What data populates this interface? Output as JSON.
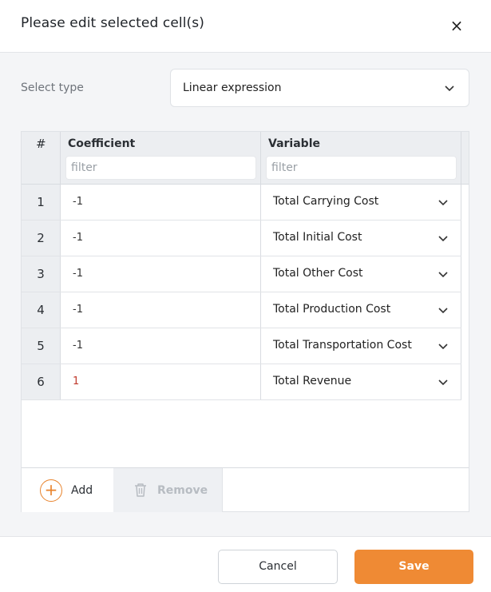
{
  "dialog": {
    "title": "Please edit selected cell(s)",
    "close_icon": "close-icon",
    "close_glyph": "×"
  },
  "type_select": {
    "label": "Select type",
    "value": "Linear expression",
    "icon": "chevron-down-icon"
  },
  "table": {
    "columns": {
      "num": "#",
      "coefficient": "Coefficient",
      "variable": "Variable"
    },
    "filter_placeholder": "filter",
    "rows": [
      {
        "num": "1",
        "coefficient": "-1",
        "variable": "Total Carrying Cost"
      },
      {
        "num": "2",
        "coefficient": "-1",
        "variable": "Total Initial Cost"
      },
      {
        "num": "3",
        "coefficient": "-1",
        "variable": "Total Other Cost"
      },
      {
        "num": "4",
        "coefficient": "-1",
        "variable": "Total Production Cost"
      },
      {
        "num": "5",
        "coefficient": "-1",
        "variable": "Total Transportation Cost"
      },
      {
        "num": "6",
        "coefficient": "1",
        "variable": "Total Revenue"
      }
    ]
  },
  "toolbar": {
    "add_label": "Add",
    "add_icon": "plus-circle-icon",
    "add_glyph": "+",
    "remove_label": "Remove",
    "remove_icon": "trash-icon"
  },
  "footer": {
    "cancel_label": "Cancel",
    "save_label": "Save"
  },
  "colors": {
    "accent": "#ef8a34",
    "positive_value": "#c0392b"
  }
}
